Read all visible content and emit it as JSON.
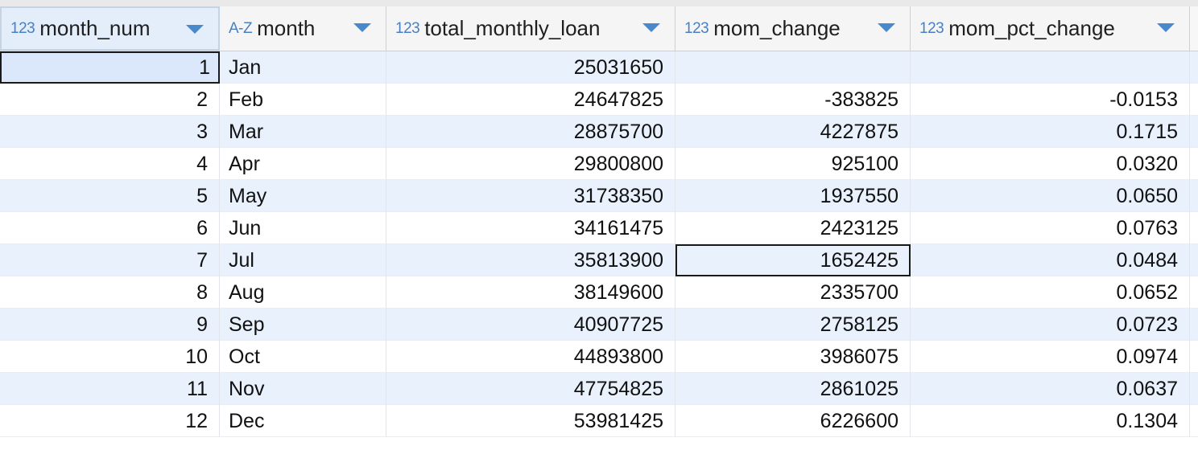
{
  "columns": [
    {
      "type": "123",
      "name": "month_num"
    },
    {
      "type": "A-Z",
      "name": "month"
    },
    {
      "type": "123",
      "name": "total_monthly_loan"
    },
    {
      "type": "123",
      "name": "mom_change"
    },
    {
      "type": "123",
      "name": "mom_pct_change"
    }
  ],
  "rows": [
    [
      "1",
      "Jan",
      "25031650",
      "",
      ""
    ],
    [
      "2",
      "Feb",
      "24647825",
      "-383825",
      "-0.0153"
    ],
    [
      "3",
      "Mar",
      "28875700",
      "4227875",
      "0.1715"
    ],
    [
      "4",
      "Apr",
      "29800800",
      "925100",
      "0.0320"
    ],
    [
      "5",
      "May",
      "31738350",
      "1937550",
      "0.0650"
    ],
    [
      "6",
      "Jun",
      "34161475",
      "2423125",
      "0.0763"
    ],
    [
      "7",
      "Jul",
      "35813900",
      "1652425",
      "0.0484"
    ],
    [
      "8",
      "Aug",
      "38149600",
      "2335700",
      "0.0652"
    ],
    [
      "9",
      "Sep",
      "40907725",
      "2758125",
      "0.0723"
    ],
    [
      "10",
      "Oct",
      "44893800",
      "3986075",
      "0.0974"
    ],
    [
      "11",
      "Nov",
      "47754825",
      "2861025",
      "0.0637"
    ],
    [
      "12",
      "Dec",
      "53981425",
      "6226600",
      "0.1304"
    ]
  ],
  "icons": {
    "sort": "chevron-down-icon"
  },
  "colors": {
    "type_label": "#4a7fc1",
    "row_alt": "#e8f1fc",
    "header_bg": "#f5f5f5",
    "arrow": "#4a88cc"
  }
}
